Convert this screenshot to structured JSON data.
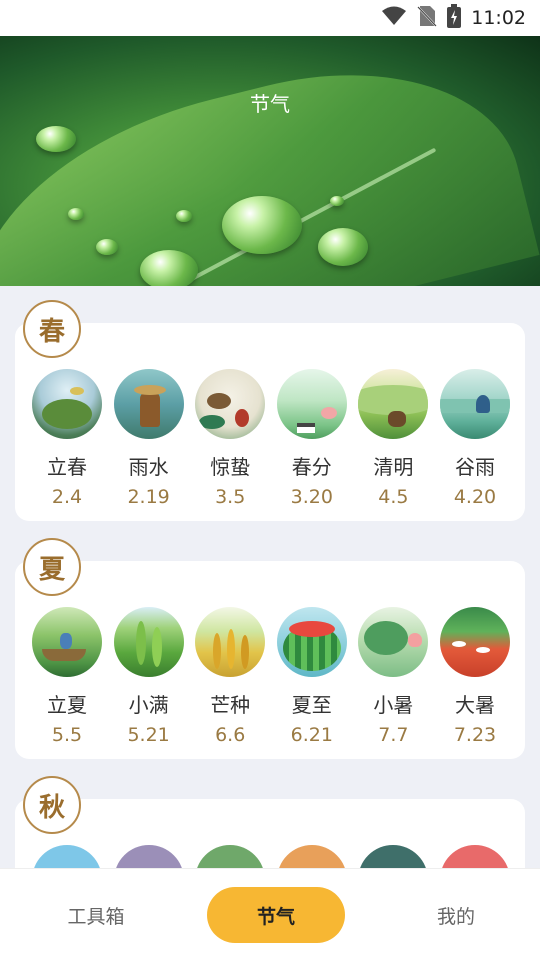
{
  "status_bar": {
    "time": "11:02"
  },
  "header": {
    "title": "节气"
  },
  "seasons": [
    {
      "badge": "春",
      "terms": [
        {
          "name": "立春",
          "date": "2.4"
        },
        {
          "name": "雨水",
          "date": "2.19"
        },
        {
          "name": "惊蛰",
          "date": "3.5"
        },
        {
          "name": "春分",
          "date": "3.20"
        },
        {
          "name": "清明",
          "date": "4.5"
        },
        {
          "name": "谷雨",
          "date": "4.20"
        }
      ]
    },
    {
      "badge": "夏",
      "terms": [
        {
          "name": "立夏",
          "date": "5.5"
        },
        {
          "name": "小满",
          "date": "5.21"
        },
        {
          "name": "芒种",
          "date": "6.6"
        },
        {
          "name": "夏至",
          "date": "6.21"
        },
        {
          "name": "小暑",
          "date": "7.7"
        },
        {
          "name": "大暑",
          "date": "7.23"
        }
      ]
    },
    {
      "badge": "秋"
    }
  ],
  "tabs": [
    {
      "label": "工具箱"
    },
    {
      "label": "节气",
      "active": true
    },
    {
      "label": "我的"
    }
  ]
}
